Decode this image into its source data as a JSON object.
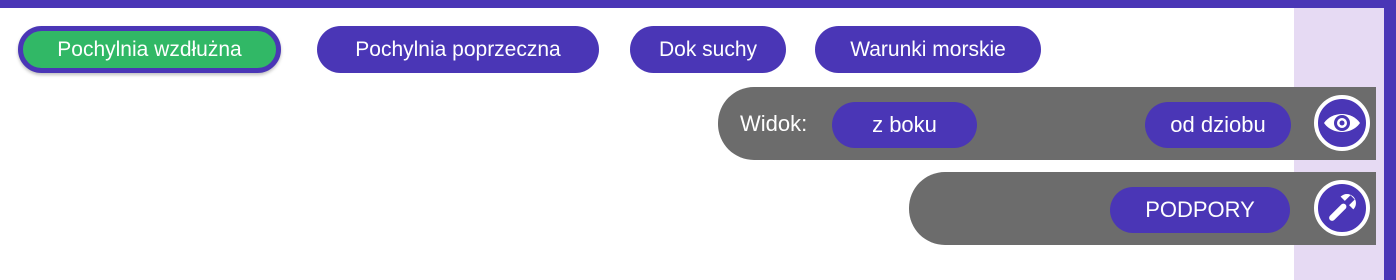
{
  "tabs": [
    {
      "label": "Pochylnia wzdłużna",
      "active": true
    },
    {
      "label": "Pochylnia poprzeczna",
      "active": false
    },
    {
      "label": "Dok suchy",
      "active": false
    },
    {
      "label": "Warunki morskie",
      "active": false
    }
  ],
  "view_bar": {
    "label": "Widok:",
    "option_side": "z boku",
    "option_bow": "od dziobu",
    "icon": "eye-icon"
  },
  "tools_bar": {
    "supports_label": "PODPORY",
    "icon": "wrench-icon"
  },
  "colors": {
    "primary": "#4a36b6",
    "active_tab": "#31b866",
    "toolbar": "#6c6c6c",
    "side_panel": "#e6daf3",
    "text": "#ffffff"
  }
}
